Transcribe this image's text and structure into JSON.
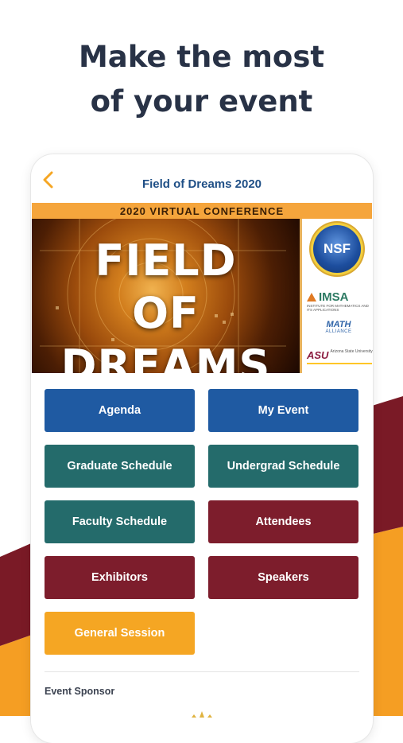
{
  "promo": {
    "line1": "Make the most",
    "line2": "of your event"
  },
  "header": {
    "title": "Field of Dreams 2020"
  },
  "banner": {
    "ribbon_text": "2020 VIRTUAL CONFERENCE",
    "hero_line1": "FIELD",
    "hero_line2": "OF DREAMS",
    "sponsor_logos": {
      "nsf": "NSF",
      "imsa": "IMSA",
      "imsa_sub": "Institute for Mathematics and its Applications",
      "math": "MATH",
      "math_sub": "ALLIANCE",
      "asu": "ASU",
      "asu_sub": "Arizona State University"
    }
  },
  "menu": {
    "buttons": [
      {
        "label": "Agenda",
        "color": "#1f5aa2"
      },
      {
        "label": "My Event",
        "color": "#1f5aa2"
      },
      {
        "label": "Graduate Schedule",
        "color": "#246b6b"
      },
      {
        "label": "Undergrad Schedule",
        "color": "#246b6b"
      },
      {
        "label": "Faculty Schedule",
        "color": "#246b6b"
      },
      {
        "label": "Attendees",
        "color": "#7d1d2c"
      },
      {
        "label": "Exhibitors",
        "color": "#7d1d2c"
      },
      {
        "label": "Speakers",
        "color": "#7d1d2c"
      },
      {
        "label": "General Session",
        "color": "#f5a623"
      }
    ]
  },
  "sponsor_section": {
    "label": "Event Sponsor"
  },
  "colors": {
    "title_blue": "#1f4f86",
    "accent_orange": "#f5a623",
    "maroon": "#7d1d2c",
    "teal": "#246b6b",
    "blue": "#1f5aa2",
    "promo_text": "#283246"
  },
  "icons": {
    "back": "chevron-left-icon"
  }
}
